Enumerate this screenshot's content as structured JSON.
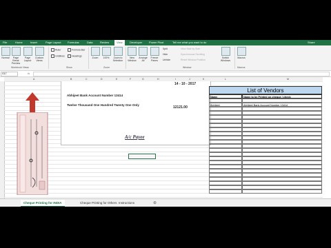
{
  "ribbon_tabs": [
    "File",
    "Home",
    "Insert",
    "Page Layout",
    "Formulas",
    "Data",
    "Review",
    "View",
    "Developer",
    "Power Pivot"
  ],
  "active_tab": "View",
  "tell_me": "Tell me what you want to do",
  "share": "Share",
  "ribbon": {
    "views": [
      "Normal",
      "Page Break Preview",
      "Page Layout",
      "Custom Views"
    ],
    "show": {
      "ruler": "Ruler",
      "gridlines": "Gridlines",
      "formula_bar": "Formula Bar",
      "headings": "Headings"
    },
    "zoom": [
      "Zoom",
      "100%",
      "Zoom to Selection"
    ],
    "window": [
      "New Window",
      "Arrange All",
      "Freeze Panes"
    ],
    "window_small": [
      "Split",
      "Hide",
      "Unhide"
    ],
    "window_gray": [
      "View Side by Side",
      "Synchronous Scrolling",
      "Reset Window Position"
    ],
    "switch": "Switch Windows",
    "macros": "Macros",
    "group_labels": [
      "Workbook Views",
      "Show",
      "Zoom",
      "Window",
      "Macros"
    ]
  },
  "name_box": "G17",
  "fx": "fx",
  "columns": [
    "A",
    "B",
    "C",
    "D",
    "E",
    "F",
    "G",
    "H",
    "I",
    "J",
    "K",
    "L",
    "M"
  ],
  "cheque": {
    "date": "14 - 10 - 2017",
    "payee_name": "Abhijeet Bank Account Number 13414",
    "amount_words": "Twelve Thousand One Hundred Twenty One Only",
    "amount": "12121.00",
    "stamp": "A/c Payee"
  },
  "vendors": {
    "title": "List of Vendors",
    "col_name": "Name",
    "col_print": "Name to be Printed on cheque / check",
    "rows": [
      {
        "name": "Abhijeet",
        "print": "Abhijeet Bank Account Number 13414"
      }
    ]
  },
  "sheet_tabs": [
    "Cheque Printing for INDIA",
    "Cheque Printing for Others",
    "Instructions"
  ],
  "active_sheet": "Cheque Printing for INDIA",
  "colors": {
    "excel_green": "#217346",
    "vendor_header": "#bdd7ee",
    "arrow": "#c0392b"
  }
}
